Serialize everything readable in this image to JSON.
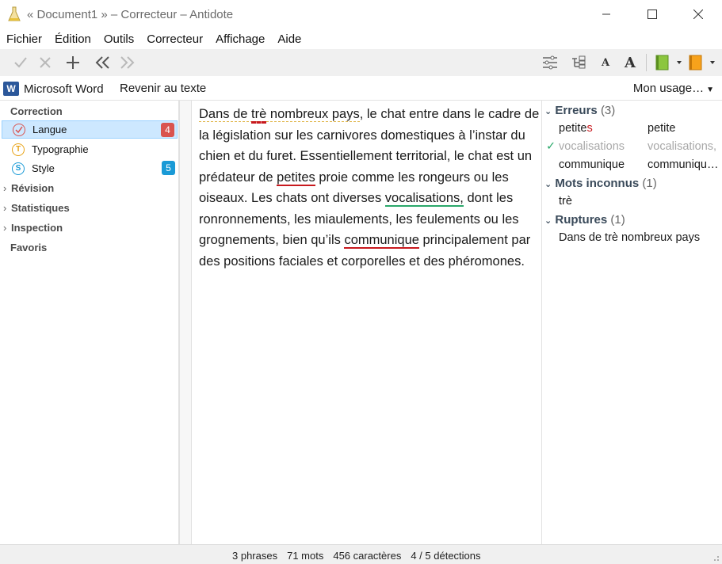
{
  "window": {
    "title": "« Document1 » – Correcteur – Antidote",
    "controls": {
      "minimize": "minimize-icon",
      "maximize": "maximize-icon",
      "close": "close-icon"
    }
  },
  "menu": [
    "Fichier",
    "Édition",
    "Outils",
    "Correcteur",
    "Affichage",
    "Aide"
  ],
  "toolbar": {
    "left_icons": [
      "check-icon",
      "cross-icon",
      "plus-icon",
      "double-chevron-left-icon",
      "double-chevron-right-icon"
    ],
    "right_icons": [
      "sliders-icon",
      "tree-icon",
      "font-small-icon",
      "font-large-icon",
      "green-book-icon",
      "orange-book-icon"
    ],
    "font_small": "A",
    "font_large": "A"
  },
  "subbar": {
    "word_icon_letter": "W",
    "word_label": "Microsoft Word",
    "return_label": "Revenir au texte",
    "usage_label": "Mon usage…"
  },
  "left": {
    "correction_header": "Correction",
    "categories": [
      {
        "label": "Langue",
        "badge": "4",
        "icon_letter": "",
        "color": "#d9534f"
      },
      {
        "label": "Typographie",
        "badge": "",
        "icon_letter": "T",
        "color": "#e8a317"
      },
      {
        "label": "Style",
        "badge": "5",
        "icon_letter": "S",
        "color": "#1a9ad6"
      }
    ],
    "sections": [
      "Révision",
      "Statistiques",
      "Inspection"
    ],
    "favoris": "Favoris"
  },
  "text": {
    "s1_a": "Dans de ",
    "s1_err": "trè",
    "s1_b": " nombreux pays",
    "s1_c": ", le chat entre dans le cadre de la législation sur les carnivores domestiques à l’instar du chien et du furet. Essentiellement territorial, le chat est un prédateur de ",
    "err_petites": "petites",
    "s2": " proie comme les rongeurs ou les oiseaux. Les chats ont diverses ",
    "err_vocal": "vocalisations,",
    "s3": " dont les ronronnements, les miaulements, les feulements ou les grognements, bien qu’ils ",
    "err_comm": "communique",
    "s4": " principalement par des positions faciales et corporelles et des phéromones."
  },
  "right": {
    "errors_title": "Erreurs",
    "errors_count": "(3)",
    "errors": [
      {
        "found_pre": "petite",
        "found_red": "s",
        "suggestion": "petite",
        "done": false
      },
      {
        "found_pre": "vocalisations",
        "found_red": "",
        "suggestion": "vocalisations,",
        "done": true
      },
      {
        "found_pre": "communique",
        "found_red": "",
        "suggestion": "communiqu…",
        "done": false
      }
    ],
    "unknown_title": "Mots inconnus",
    "unknown_count": "(1)",
    "unknown": [
      "trè"
    ],
    "breaks_title": "Ruptures",
    "breaks_count": "(1)",
    "breaks": [
      "Dans de trè nombreux pays"
    ]
  },
  "status": {
    "phrases": "3 phrases",
    "mots": "71 mots",
    "caracteres": "456 caractères",
    "detections": "4 / 5 détections"
  },
  "colors": {
    "error_red": "#c8191e",
    "style_green": "#2aa86a",
    "selection": "#cde8ff",
    "badge_red": "#d9534f",
    "badge_blue": "#1a9ad6"
  }
}
